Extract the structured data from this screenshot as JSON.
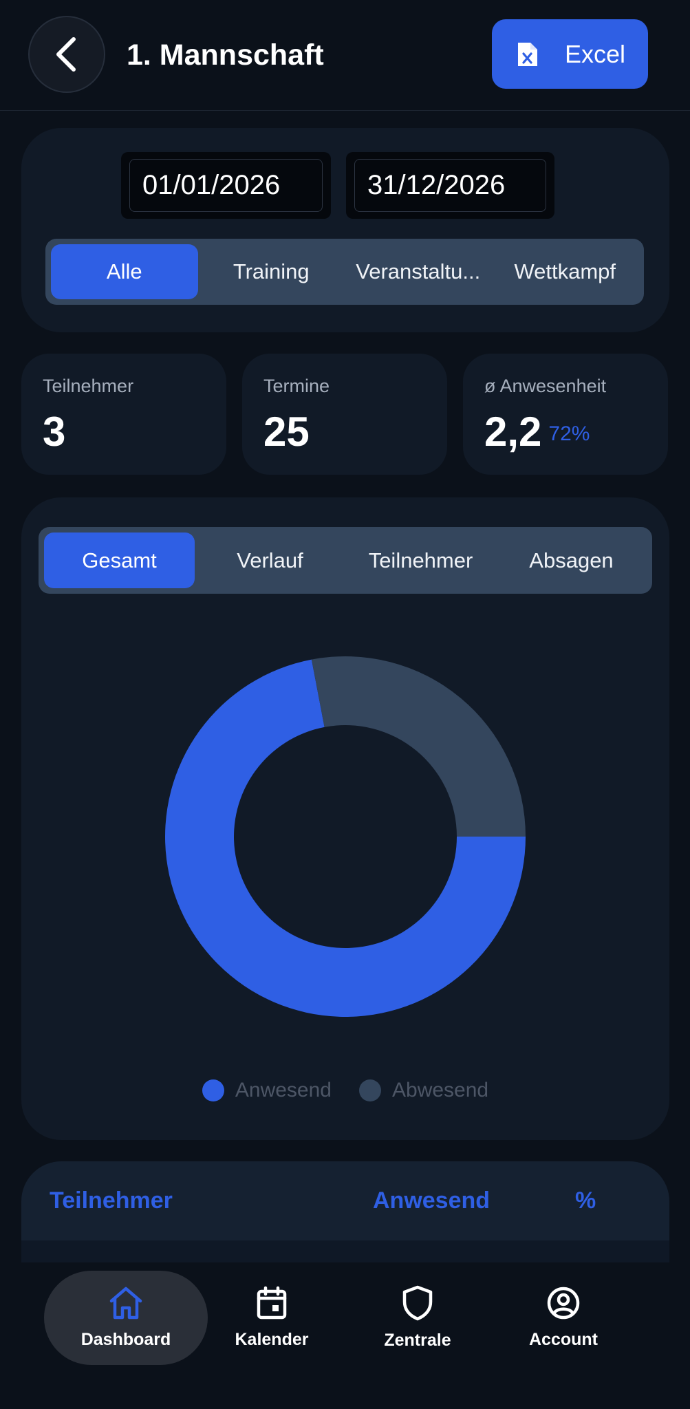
{
  "header": {
    "title": "1. Mannschaft",
    "back_icon": "chevron-left-icon",
    "export_label": "Excel",
    "export_icon": "excel-file-icon"
  },
  "filters": {
    "date_from": "01/01/2026",
    "date_to": "31/12/2026",
    "types": [
      "Alle",
      "Training",
      "Veranstaltu...",
      "Wettkampf"
    ],
    "active_type": "Alle"
  },
  "stats": {
    "participants_label": "Teilnehmer",
    "participants_value": "3",
    "events_label": "Termine",
    "events_value": "25",
    "attendance_label": "ø Anwesenheit",
    "attendance_value": "2,2",
    "attendance_pct": "72%"
  },
  "chart_tabs": {
    "tabs": [
      "Gesamt",
      "Verlauf",
      "Teilnehmer",
      "Absagen"
    ],
    "active": "Gesamt"
  },
  "chart_data": {
    "type": "pie",
    "variant": "donut",
    "categories": [
      "Anwesend",
      "Abwesend"
    ],
    "values": [
      72,
      28
    ],
    "colors": [
      "#2f5fe4",
      "#34465d"
    ],
    "legend_position": "bottom"
  },
  "table": {
    "col_participant": "Teilnehmer",
    "col_present": "Anwesend",
    "col_pct": "%"
  },
  "nav": {
    "items": [
      {
        "label": "Dashboard",
        "icon": "home-icon"
      },
      {
        "label": "Kalender",
        "icon": "calendar-icon"
      },
      {
        "label": "Zentrale",
        "icon": "shield-icon"
      },
      {
        "label": "Account",
        "icon": "account-circle-icon"
      }
    ],
    "active": "Dashboard"
  },
  "colors": {
    "accent": "#2f5fe4",
    "background": "#0b111a",
    "card": "#111a27",
    "segment": "#34465d"
  }
}
